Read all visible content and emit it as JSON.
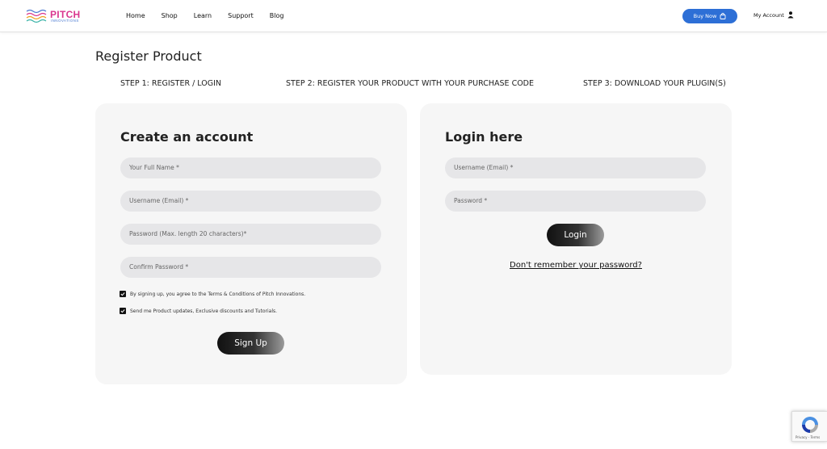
{
  "brand": {
    "name": "PITCH",
    "tagline": "INNOVATIONS",
    "colors": {
      "primary": "#d9368f",
      "secondary": "#4a7ad1",
      "accent": "#2d6fd6"
    }
  },
  "nav": {
    "items": [
      {
        "label": "Home"
      },
      {
        "label": "Shop"
      },
      {
        "label": "Learn"
      },
      {
        "label": "Support"
      },
      {
        "label": "Blog"
      }
    ]
  },
  "header": {
    "buy_now_label": "Buy Now",
    "buy_now_icon": "shopping-bag-icon",
    "account_label": "My Account",
    "account_icon": "user-icon"
  },
  "page": {
    "title": "Register Product"
  },
  "steps": [
    {
      "label": "STEP 1: REGISTER / LOGIN"
    },
    {
      "label": "STEP 2: REGISTER YOUR PRODUCT WITH YOUR PURCHASE CODE"
    },
    {
      "label": "STEP 3: DOWNLOAD YOUR PLUGIN(S)"
    }
  ],
  "signup": {
    "title": "Create an account",
    "fields": [
      {
        "placeholder": "Your Full Name *",
        "value": ""
      },
      {
        "placeholder": "Username (Email) *",
        "value": ""
      },
      {
        "placeholder": "Password (Max. length 20 characters)*",
        "value": ""
      },
      {
        "placeholder": "Confirm Password *",
        "value": ""
      }
    ],
    "checkboxes": [
      {
        "label": "By signing up, you agree to the Terms & Conditions of Pitch Innovations.",
        "checked": true
      },
      {
        "label": "Send me Product updates, Exclusive discounts and Tutorials.",
        "checked": true
      }
    ],
    "button_label": "Sign Up"
  },
  "login": {
    "title": "Login here",
    "fields": [
      {
        "placeholder": "Username (Email) *",
        "value": ""
      },
      {
        "placeholder": "Password *",
        "value": ""
      }
    ],
    "button_label": "Login",
    "forgot_label": "Don't remember your password?"
  },
  "recaptcha": {
    "text": "Privacy - Terms"
  }
}
